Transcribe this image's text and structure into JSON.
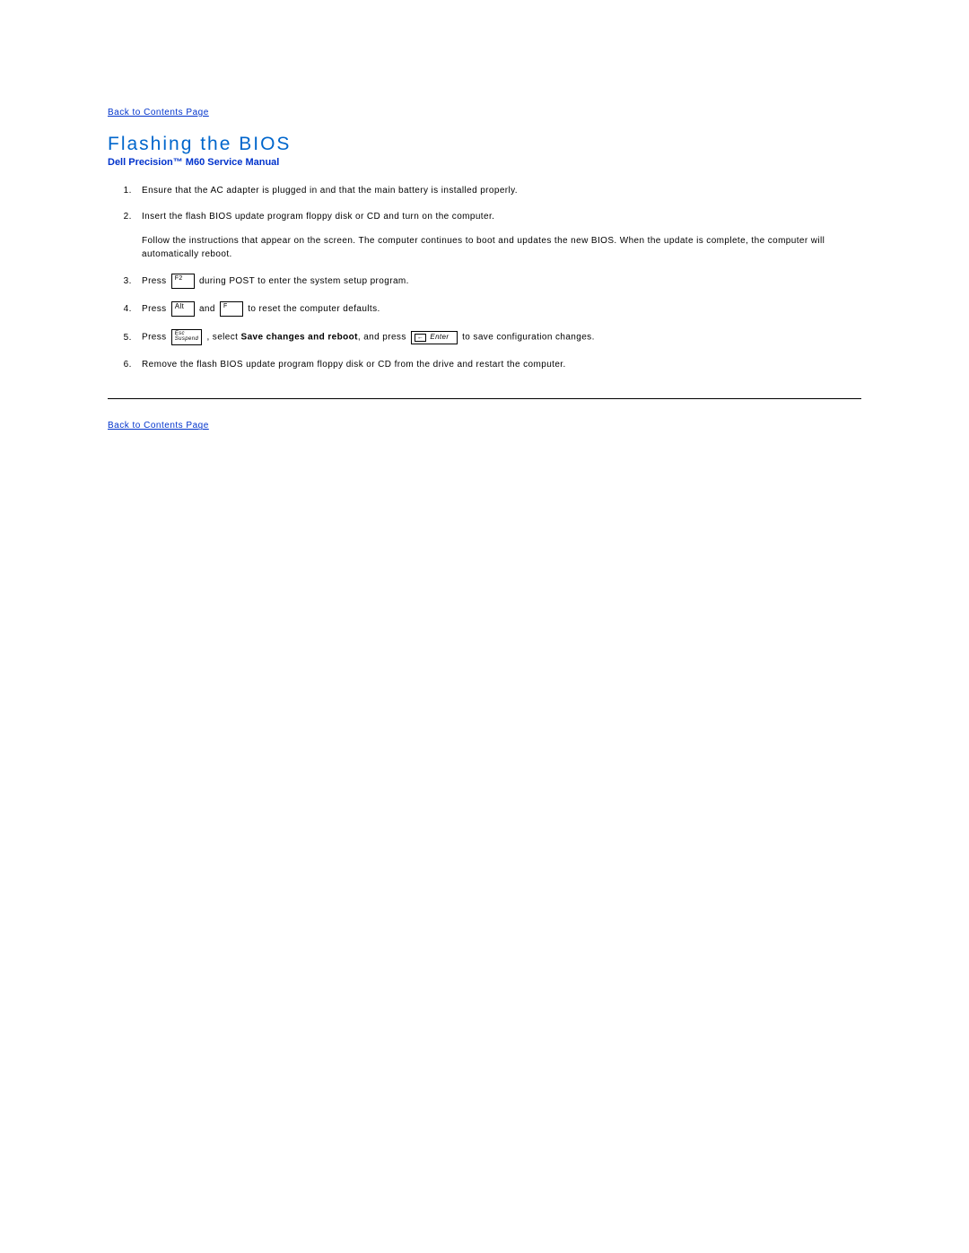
{
  "links": {
    "back_top": "Back to Contents Page",
    "back_bottom": "Back to Contents Page"
  },
  "heading": "Flashing the BIOS",
  "subtitle": "Dell Precision™ M60 Service Manual",
  "steps": {
    "s1": "Ensure that the AC adapter is plugged in and that the main battery is installed properly.",
    "s2": "Insert the flash BIOS update program floppy disk or CD and turn on the computer.",
    "s2b": "Follow the instructions that appear on the screen. The computer continues to boot and updates the new BIOS. When the update is complete, the computer will automatically reboot.",
    "s3_pre": "Press ",
    "s3_post": " during POST to enter the system setup program.",
    "s4_pre": "Press ",
    "s4_mid": " and ",
    "s4_post": " to reset the computer defaults.",
    "s5_pre": "Press ",
    "s5_mid1": ", select ",
    "s5_bold": "Save changes and reboot",
    "s5_mid2": ", and press ",
    "s5_post": " to save configuration changes.",
    "s6": "Remove the flash BIOS update program floppy disk or CD from the drive and restart the computer."
  },
  "keycaps": {
    "f2": "F2",
    "alt": "Alt",
    "f": "F",
    "esc_top": "Esc",
    "esc_bottom": "Suspend",
    "enter_arrow": "←",
    "enter_label": "Enter"
  }
}
